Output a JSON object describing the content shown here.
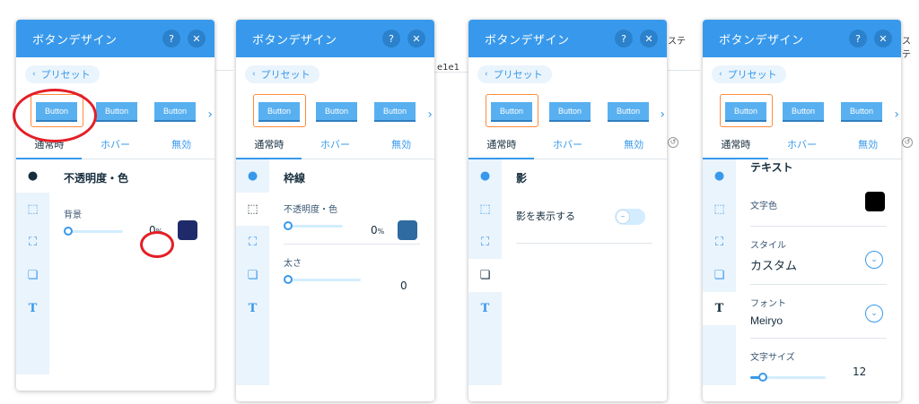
{
  "panel": {
    "title": "ボタンデザイン",
    "help_icon": "question-icon",
    "close_icon": "close-icon",
    "preset_label": "プリセット",
    "thumb_label": "Button",
    "tabs": [
      "通常時",
      "ホバー",
      "無効"
    ]
  },
  "background_fragments": {
    "p2_code": "e1e1",
    "p3_text": "ステ",
    "p4_text": "ステ"
  },
  "panel1": {
    "section_title": "不透明度・色",
    "bg_label": "背景",
    "opacity_value": "0",
    "opacity_unit": "%",
    "opacity_fraction": 0.0,
    "swatch_color": "#1f2a6b"
  },
  "panel2": {
    "section_title": "枠線",
    "opacity_label": "不透明度・色",
    "opacity_value": "0",
    "opacity_unit": "%",
    "swatch_color": "#2f6aa0",
    "width_label": "太さ",
    "width_value": "0"
  },
  "panel3": {
    "section_title": "影",
    "shadow_label": "影を表示する",
    "shadow_enabled": false
  },
  "panel4": {
    "section_title": "テキスト",
    "color_label": "文字色",
    "color_value": "#000000",
    "style_label": "スタイル",
    "style_value": "カスタム",
    "font_label": "フォント",
    "font_value": "Meiryo",
    "size_label": "文字サイズ",
    "size_value": "12"
  },
  "colors": {
    "header": "#3899ec",
    "accent": "#3899ec",
    "highlight_ring": "#e41e26",
    "selected_frame": "#ff8a3d"
  }
}
